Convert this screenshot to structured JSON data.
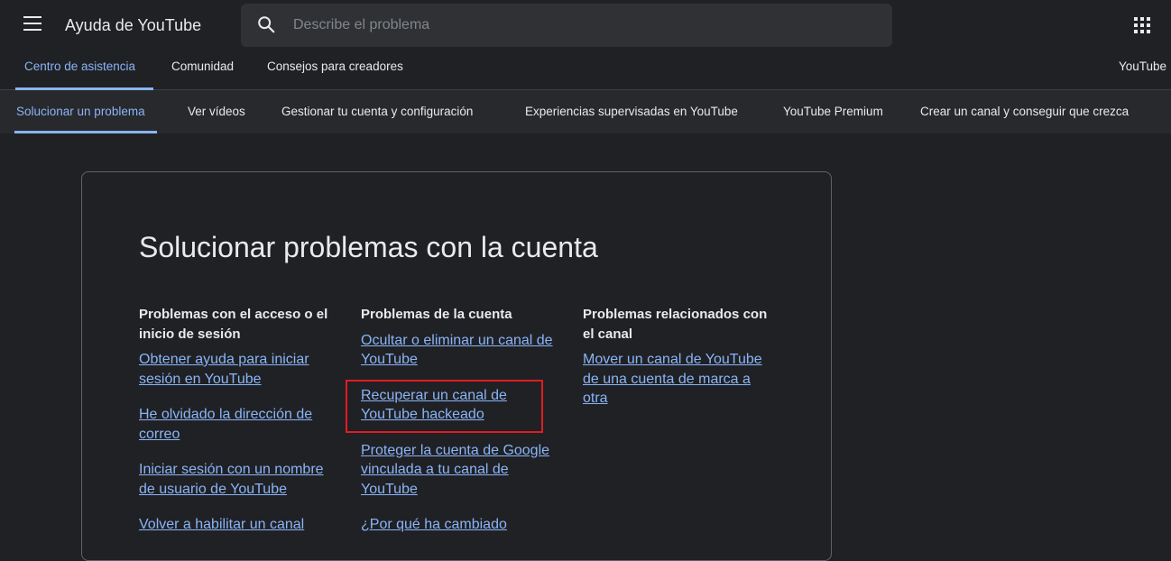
{
  "header": {
    "title": "Ayuda de YouTube",
    "search_placeholder": "Describe el problema"
  },
  "primary_tabs": [
    {
      "label": "Centro de asistencia",
      "active": true
    },
    {
      "label": "Comunidad"
    },
    {
      "label": "Consejos para creadores"
    },
    {
      "label": "YouTube"
    }
  ],
  "secondary_tabs": [
    {
      "label": "Solucionar un problema",
      "active": true
    },
    {
      "label": "Ver vídeos"
    },
    {
      "label": "Gestionar tu cuenta y configuración"
    },
    {
      "label": "Experiencias supervisadas en YouTube"
    },
    {
      "label": "YouTube Premium"
    },
    {
      "label": "Crear un canal y conseguir que crezca"
    }
  ],
  "card": {
    "title": "Solucionar problemas con la cuenta",
    "columns": [
      {
        "heading": "Problemas con el acceso o el inicio de sesión",
        "links": [
          "Obtener ayuda para iniciar sesión en YouTube",
          "He olvidado la dirección de correo",
          "Iniciar sesión con un nombre de usuario de YouTube",
          "Volver a habilitar un canal"
        ]
      },
      {
        "heading": "Problemas de la cuenta",
        "links": [
          "Ocultar o eliminar un canal de YouTube",
          "Recuperar un canal de YouTube hackeado",
          "Proteger la cuenta de Google vinculada a tu canal de YouTube",
          "¿Por qué ha cambiado"
        ]
      },
      {
        "heading": "Problemas relacionados con el canal",
        "links": [
          "Mover un canal de YouTube de una cuenta de marca a otra"
        ]
      }
    ]
  },
  "colors": {
    "background": "#202124",
    "accent": "#8ab4f8",
    "highlight_box": "#e31b23"
  }
}
